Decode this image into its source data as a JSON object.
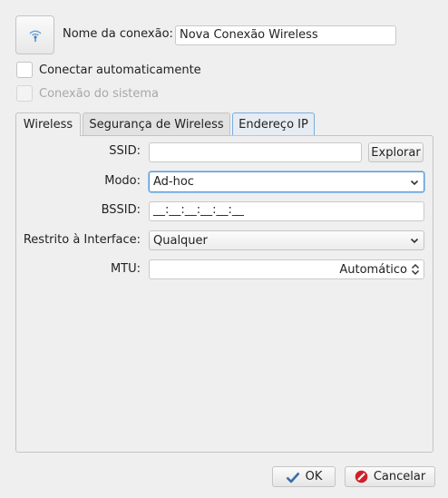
{
  "connection": {
    "icon": "wifi-signal-icon",
    "name_label": "Nome da conexão:",
    "name_value": "Nova Conexão Wireless"
  },
  "checkboxes": {
    "auto_connect": "Conectar automaticamente",
    "system_connection": "Conexão do sistema"
  },
  "tabs": [
    {
      "label": "Wireless",
      "active": true
    },
    {
      "label": "Segurança de Wireless",
      "active": false
    },
    {
      "label": "Endereço IP",
      "active": false
    }
  ],
  "form": {
    "ssid_label": "SSID:",
    "ssid_value": "",
    "explore_label": "Explorar",
    "mode_label": "Modo:",
    "mode_value": "Ad-hoc",
    "bssid_label": "BSSID:",
    "bssid_value": "__:__:__:__:__:__",
    "restrict_label": "Restrito à Interface:",
    "restrict_value": "Qualquer",
    "mtu_label": "MTU:",
    "mtu_value": "Automático"
  },
  "buttons": {
    "ok": "OK",
    "cancel": "Cancelar"
  },
  "colors": {
    "focus_blue": "#5e9bd6",
    "ok_icon": "#3a6ea5",
    "cancel_icon": "#d0202a"
  }
}
